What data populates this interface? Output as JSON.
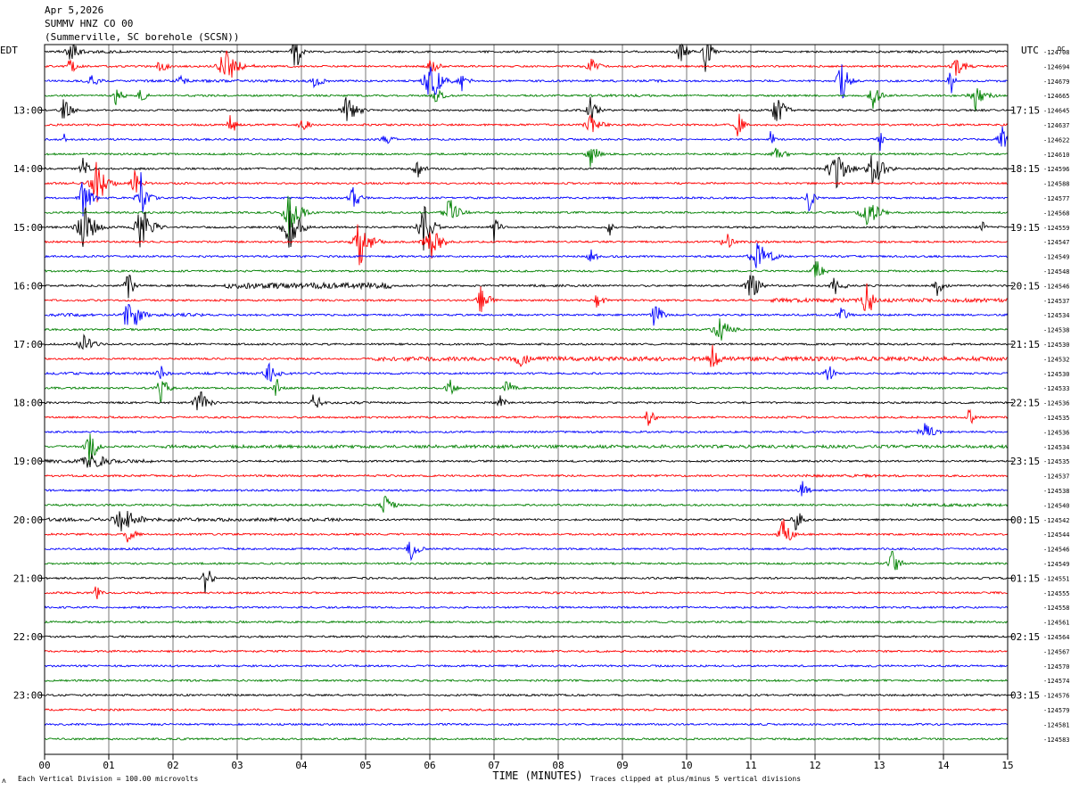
{
  "header": {
    "date": "Apr 5,2026",
    "station": "SUMMV HNZ CO 00",
    "location": "(Summerville, SC borehole (SCSN))"
  },
  "left_tz": "EDT",
  "right_tz": "UTC",
  "corner_mark": "DC",
  "footer": {
    "scale_note": "Each Vertical Division =  100.00 microvolts",
    "clip_note": "Traces clipped at plus/minus 5 vertical divisions",
    "corner_glyph": "ʌ"
  },
  "chart_data": {
    "type": "helicorder",
    "xlabel": "TIME (MINUTES)",
    "x_ticks": [
      "00",
      "01",
      "02",
      "03",
      "04",
      "05",
      "06",
      "07",
      "08",
      "09",
      "10",
      "11",
      "12",
      "13",
      "14",
      "15"
    ],
    "xlim": [
      0,
      15
    ],
    "trace_colors": [
      "#000000",
      "#ff0000",
      "#0000ff",
      "#008000"
    ],
    "left_hour_labels": [
      "13:00",
      "14:00",
      "15:00",
      "16:00",
      "17:00",
      "18:00",
      "19:00",
      "20:00",
      "21:00",
      "22:00",
      "23:00"
    ],
    "right_hour_labels": [
      "17:15",
      "18:15",
      "19:15",
      "20:15",
      "21:15",
      "22:15",
      "23:15",
      "00:15",
      "01:15",
      "02:15",
      "03:15"
    ],
    "hour_label_first_row": 4,
    "right_values": [
      "-124708",
      "-124694",
      "-124679",
      "-124665",
      "-124645",
      "-124637",
      "-124622",
      "-124610",
      "-124596",
      "-124588",
      "-124577",
      "-124568",
      "-124559",
      "-124547",
      "-124549",
      "-124548",
      "-124546",
      "-124537",
      "-124534",
      "-124538",
      "-124530",
      "-124532",
      "-124530",
      "-124533",
      "-124536",
      "-124535",
      "-124536",
      "-124534",
      "-124535",
      "-124537",
      "-124538",
      "-124540",
      "-124542",
      "-124544",
      "-124546",
      "-124549",
      "-124551",
      "-124555",
      "-124558",
      "-124561",
      "-124564",
      "-124567",
      "-124570",
      "-124574",
      "-124576",
      "-124579",
      "-124581",
      "-124583"
    ],
    "rows": 48,
    "events": [
      [
        0,
        0.4,
        0.25,
        2.5
      ],
      [
        0,
        3.9,
        0.15,
        5
      ],
      [
        0,
        9.9,
        0.15,
        5
      ],
      [
        0,
        10.3,
        0.15,
        5
      ],
      [
        1,
        0.4,
        0.2,
        2
      ],
      [
        1,
        1.8,
        0.15,
        3
      ],
      [
        1,
        2.8,
        0.3,
        5
      ],
      [
        1,
        6.0,
        0.25,
        2
      ],
      [
        1,
        8.5,
        0.25,
        1.8
      ],
      [
        1,
        14.2,
        0.3,
        2
      ],
      [
        2,
        0.7,
        0.3,
        1.5
      ],
      [
        2,
        2.1,
        0.2,
        1.5
      ],
      [
        2,
        4.2,
        0.3,
        1.5
      ],
      [
        2,
        6.0,
        0.3,
        5
      ],
      [
        2,
        6.5,
        0.2,
        2
      ],
      [
        2,
        12.4,
        0.2,
        5
      ],
      [
        2,
        14.1,
        0.1,
        4
      ],
      [
        3,
        1.1,
        0.2,
        2.2
      ],
      [
        3,
        1.5,
        0.2,
        1.5
      ],
      [
        3,
        6.1,
        0.2,
        2
      ],
      [
        3,
        12.9,
        0.2,
        3
      ],
      [
        3,
        14.5,
        0.3,
        3
      ],
      [
        4,
        0.3,
        0.2,
        3
      ],
      [
        4,
        4.7,
        0.3,
        3
      ],
      [
        4,
        8.5,
        0.2,
        3
      ],
      [
        4,
        11.4,
        0.2,
        5
      ],
      [
        5,
        2.9,
        0.15,
        3
      ],
      [
        5,
        4.0,
        0.2,
        2
      ],
      [
        5,
        8.5,
        0.3,
        2
      ],
      [
        5,
        10.8,
        0.15,
        3
      ],
      [
        6,
        0.3,
        0.1,
        1.5
      ],
      [
        6,
        5.3,
        0.2,
        2
      ],
      [
        6,
        11.3,
        0.1,
        3
      ],
      [
        6,
        13.0,
        0.1,
        3
      ],
      [
        6,
        14.9,
        0.2,
        3
      ],
      [
        7,
        8.5,
        0.2,
        3
      ],
      [
        7,
        11.4,
        0.3,
        1.5
      ],
      [
        8,
        0.6,
        0.15,
        3
      ],
      [
        8,
        5.8,
        0.2,
        2
      ],
      [
        8,
        12.3,
        0.3,
        5
      ],
      [
        8,
        12.9,
        0.3,
        4
      ],
      [
        9,
        0.8,
        0.3,
        5
      ],
      [
        9,
        1.4,
        0.2,
        3
      ],
      [
        10,
        0.6,
        0.2,
        5
      ],
      [
        10,
        1.5,
        0.2,
        5
      ],
      [
        10,
        4.8,
        0.2,
        3
      ],
      [
        10,
        11.9,
        0.15,
        3
      ],
      [
        11,
        3.8,
        0.3,
        5
      ],
      [
        11,
        6.3,
        0.3,
        3
      ],
      [
        11,
        12.8,
        0.3,
        4
      ],
      [
        12,
        0.6,
        0.3,
        5
      ],
      [
        12,
        1.5,
        0.3,
        5
      ],
      [
        12,
        3.8,
        0.3,
        5
      ],
      [
        12,
        5.9,
        0.25,
        5
      ],
      [
        12,
        7.0,
        0.15,
        3
      ],
      [
        12,
        8.8,
        0.15,
        2
      ],
      [
        12,
        14.6,
        0.1,
        1.5
      ],
      [
        13,
        4.9,
        0.3,
        5
      ],
      [
        13,
        6.0,
        0.3,
        4
      ],
      [
        13,
        10.6,
        0.2,
        2.5
      ],
      [
        14,
        8.5,
        0.15,
        2.5
      ],
      [
        14,
        11.1,
        0.4,
        3
      ],
      [
        15,
        12.0,
        0.2,
        3
      ],
      [
        16,
        1.3,
        0.2,
        3
      ],
      [
        16,
        11.0,
        0.3,
        3
      ],
      [
        16,
        12.3,
        0.2,
        3
      ],
      [
        16,
        13.9,
        0.2,
        2
      ],
      [
        17,
        6.8,
        0.2,
        4
      ],
      [
        17,
        8.6,
        0.2,
        2
      ],
      [
        17,
        12.8,
        0.2,
        5
      ],
      [
        18,
        1.3,
        0.3,
        5
      ],
      [
        18,
        9.5,
        0.2,
        3
      ],
      [
        18,
        12.4,
        0.2,
        2
      ],
      [
        19,
        10.5,
        0.3,
        3
      ],
      [
        20,
        0.6,
        0.3,
        2
      ],
      [
        21,
        7.4,
        0.3,
        2
      ],
      [
        21,
        10.4,
        0.2,
        3
      ],
      [
        22,
        1.8,
        0.2,
        2
      ],
      [
        22,
        3.5,
        0.3,
        2
      ],
      [
        22,
        12.2,
        0.2,
        2
      ],
      [
        23,
        1.8,
        0.2,
        3
      ],
      [
        23,
        3.6,
        0.15,
        2.5
      ],
      [
        23,
        6.3,
        0.2,
        2
      ],
      [
        23,
        7.2,
        0.2,
        2
      ],
      [
        24,
        2.4,
        0.25,
        3
      ],
      [
        24,
        4.2,
        0.15,
        3
      ],
      [
        24,
        7.1,
        0.15,
        2
      ],
      [
        25,
        9.4,
        0.15,
        3
      ],
      [
        25,
        14.4,
        0.1,
        3
      ],
      [
        26,
        13.7,
        0.3,
        2
      ],
      [
        27,
        0.7,
        0.2,
        4
      ],
      [
        28,
        0.7,
        0.5,
        2
      ],
      [
        30,
        11.8,
        0.2,
        2
      ],
      [
        31,
        5.3,
        0.2,
        3
      ],
      [
        32,
        1.2,
        0.5,
        2.5
      ],
      [
        32,
        11.7,
        0.2,
        2.5
      ],
      [
        33,
        1.3,
        0.2,
        2
      ],
      [
        33,
        11.5,
        0.2,
        4
      ],
      [
        34,
        5.7,
        0.2,
        3
      ],
      [
        35,
        13.2,
        0.2,
        3
      ],
      [
        36,
        2.5,
        0.15,
        4
      ],
      [
        37,
        0.8,
        0.15,
        2
      ]
    ],
    "noisy": [
      [
        0,
        0.2,
        1.0,
        1.5
      ],
      [
        1,
        2.7,
        0.6,
        2
      ],
      [
        2,
        1.5,
        3.0,
        1.3
      ],
      [
        2,
        8.4,
        1.2,
        1.3
      ],
      [
        3,
        8.5,
        1.0,
        1.3
      ],
      [
        9,
        0.4,
        0.4,
        1.5
      ],
      [
        16,
        2.8,
        2.6,
        3
      ],
      [
        17,
        11.3,
        3.7,
        2
      ],
      [
        18,
        0,
        2.5,
        1.6
      ],
      [
        21,
        5.1,
        10,
        2.2
      ],
      [
        22,
        0,
        4.3,
        1.3
      ],
      [
        24,
        4.2,
        0.8,
        1.3
      ],
      [
        27,
        1.7,
        13.3,
        1.6
      ],
      [
        28,
        0,
        1.7,
        1.8
      ],
      [
        29,
        11.8,
        1.6,
        1.4
      ],
      [
        31,
        13.3,
        1.7,
        1.5
      ],
      [
        32,
        0,
        4.6,
        1.8
      ],
      [
        0,
        13.5,
        1.5,
        1.2
      ],
      [
        13,
        10.5,
        1.0,
        1.2
      ],
      [
        16,
        7.0,
        1.5,
        1.2
      ]
    ]
  }
}
